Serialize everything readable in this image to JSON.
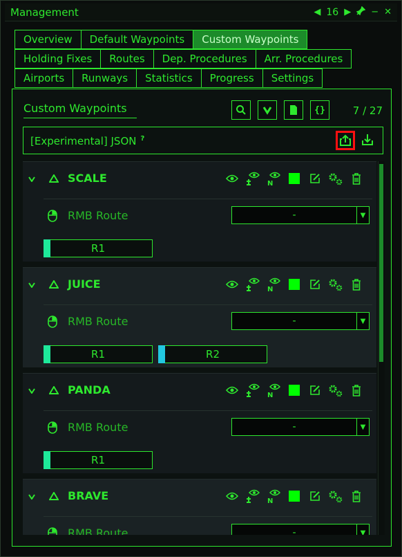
{
  "window": {
    "title": "Management",
    "page_number": "16"
  },
  "tabs": {
    "row1": [
      "Overview",
      "Default Waypoints",
      "Custom Waypoints"
    ],
    "row2": [
      "Holding Fixes",
      "Routes",
      "Dep. Procedures",
      "Arr. Procedures"
    ],
    "row3": [
      "Airports",
      "Runways",
      "Statistics",
      "Progress",
      "Settings"
    ],
    "active": "Custom Waypoints"
  },
  "panel": {
    "title": "Custom Waypoints",
    "counter": "7 / 27",
    "toolbar_icons": [
      "search-icon",
      "chevron-down-icon",
      "file-icon",
      "braces-icon"
    ],
    "json_section": {
      "label": "[Experimental] JSON",
      "help_mark": "?",
      "highlighted_icon": "export-icon",
      "import_icon": "import-icon"
    }
  },
  "waypoints": [
    {
      "name": "SCALE",
      "color": "#00ff00",
      "rmb_label": "RMB Route",
      "route_value": "-",
      "routes": [
        {
          "label": "R1",
          "color": "#1ee89a"
        }
      ]
    },
    {
      "name": "JUICE",
      "color": "#00ff00",
      "rmb_label": "RMB Route",
      "route_value": "-",
      "routes": [
        {
          "label": "R1",
          "color": "#1ee89a"
        },
        {
          "label": "R2",
          "color": "#22c8e0"
        }
      ]
    },
    {
      "name": "PANDA",
      "color": "#00ff00",
      "rmb_label": "RMB Route",
      "route_value": "-",
      "routes": [
        {
          "label": "R1",
          "color": "#1ee89a"
        }
      ]
    },
    {
      "name": "BRAVE",
      "color": "#00ff00",
      "rmb_label": "RMB Route",
      "route_value": "-",
      "routes": []
    }
  ],
  "colors": {
    "accent": "#2ee82e",
    "active_tab": "#1c8b2a",
    "highlight": "#ff1010"
  }
}
